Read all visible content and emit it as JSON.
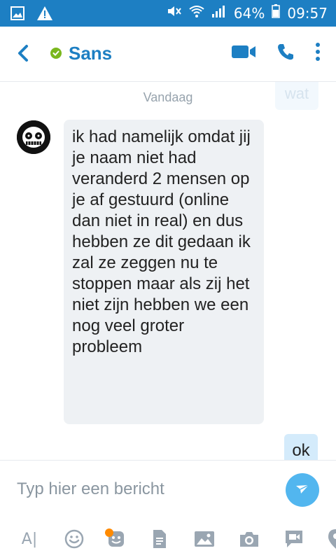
{
  "status_bar": {
    "battery": "64%",
    "time": "09:57"
  },
  "header": {
    "title": "Sans",
    "status": "online"
  },
  "chat": {
    "day_label": "Vandaag",
    "previous_out_message": "wat",
    "incoming_message": "ik had namelijk omdat jij je naam niet had veranderd 2 mensen op je af gestuurd (online dan niet in real) en dus hebben ze dit gedaan ik zal ze zeggen nu te stoppen maar als zij het niet zijn hebben we een nog veel groter probleem",
    "outgoing_message": "ok"
  },
  "composer": {
    "placeholder": "Typ hier een bericht"
  },
  "colors": {
    "accent": "#1d7fc3",
    "send": "#52b6ef",
    "online": "#7ab71d",
    "bubble_in": "#eef1f4",
    "bubble_out": "#d4ebfb"
  },
  "toolbar_icons": [
    "font-icon",
    "emoticon-icon",
    "sticker-icon",
    "file-icon",
    "gallery-icon",
    "camera-icon",
    "video-message-icon",
    "location-icon"
  ]
}
